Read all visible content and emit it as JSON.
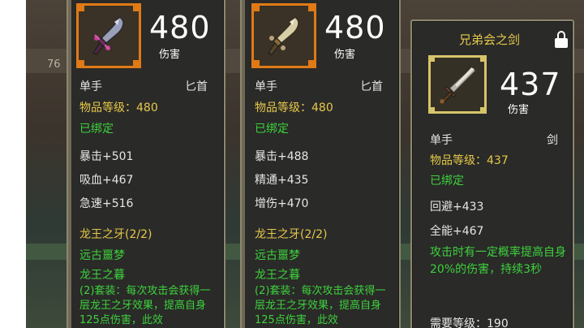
{
  "cards": [
    {
      "damage": "480",
      "damage_label": "伤害",
      "hand": "单手",
      "weapon_type": "匕首",
      "item_level": "物品等级：480",
      "bound": "已绑定",
      "stats": [
        "暴击+501",
        "吸血+467",
        "急速+516"
      ],
      "set_name": "龙王之牙(2/2)",
      "set_items": [
        "远古噩梦",
        "龙王之暮"
      ],
      "set_bonus": "(2)套装：每次攻击会获得一层龙王之牙效果，提高自身125点伤害，此效"
    },
    {
      "damage": "480",
      "damage_label": "伤害",
      "hand": "单手",
      "weapon_type": "匕首",
      "item_level": "物品等级：480",
      "bound": "已绑定",
      "stats": [
        "暴击+488",
        "精通+435",
        "增伤+470"
      ],
      "set_name": "龙王之牙(2/2)",
      "set_items": [
        "远古噩梦",
        "龙王之暮"
      ],
      "set_bonus": "(2)套装：每次攻击会获得一层龙王之牙效果，提高自身125点伤害，此效"
    },
    {
      "title": "兄弟会之剑",
      "damage": "437",
      "damage_label": "伤害",
      "hand": "单手",
      "weapon_type": "剑",
      "item_level": "物品等级：437",
      "bound": "已绑定",
      "stats": [
        "回避+433",
        "全能+467"
      ],
      "effect": "攻击时有一定概率提高自身20%的伤害，持续3秒",
      "required_level": "需要等级：190"
    }
  ],
  "background_number": "76",
  "colors": {
    "gold_text": "#e5c84a",
    "green_text": "#3dd13d",
    "orange_frame": "#e07a16",
    "card_bg": "#2a2a28"
  },
  "icons": [
    "dagger-icon",
    "dagger-icon",
    "sword-icon",
    "lock-icon"
  ]
}
